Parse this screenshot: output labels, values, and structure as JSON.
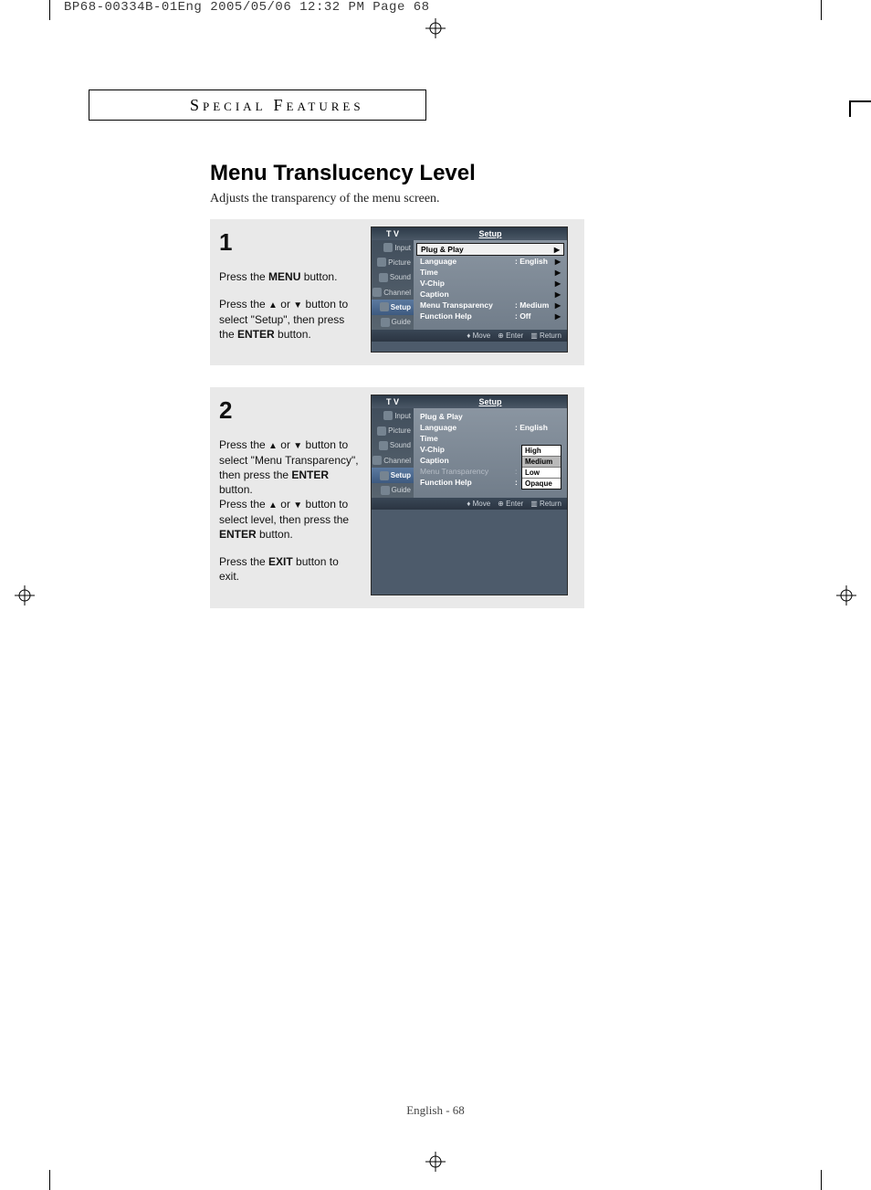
{
  "slug": "BP68-00334B-01Eng  2005/05/06  12:32 PM  Page 68",
  "section_header": "SPECIAL FEATURES",
  "title": "Menu Translucency Level",
  "subtitle": "Adjusts the transparency of the menu screen.",
  "steps": [
    {
      "num": "1",
      "paras": [
        "Press the <b>MENU</b> button.",
        "Press the <span class='tri'>▲</span> or <span class='tri'>▼</span> button to select \"Setup\", then press the <b>ENTER</b> button."
      ]
    },
    {
      "num": "2",
      "paras": [
        "Press the <span class='tri'>▲</span> or <span class='tri'>▼</span> button to select \"Menu Transparency\", then press the <b>ENTER</b> button.<br>Press the <span class='tri'>▲</span> or <span class='tri'>▼</span> button to select level, then press the <b>ENTER</b> button.",
        "Press the <b>EXIT</b> button to exit."
      ]
    }
  ],
  "osd": {
    "head_left": "T V",
    "head_right": "Setup",
    "nav": [
      "Input",
      "Picture",
      "Sound",
      "Channel",
      "Setup",
      "Guide"
    ],
    "nav_selected": "Setup",
    "foot": [
      "Move",
      "Enter",
      "Return"
    ]
  },
  "osd1": {
    "rows": [
      {
        "label": "Plug & Play",
        "value": "",
        "arrow": "▶",
        "hl": true
      },
      {
        "label": "Language",
        "value": ": English",
        "arrow": "▶"
      },
      {
        "label": "Time",
        "value": "",
        "arrow": "▶"
      },
      {
        "label": "V-Chip",
        "value": "",
        "arrow": "▶"
      },
      {
        "label": "Caption",
        "value": "",
        "arrow": "▶"
      },
      {
        "label": "Menu Transparency",
        "value": ": Medium",
        "arrow": "▶"
      },
      {
        "label": "Function Help",
        "value": ": Off",
        "arrow": "▶"
      }
    ]
  },
  "osd2": {
    "rows": [
      {
        "label": "Plug & Play",
        "value": ""
      },
      {
        "label": "Language",
        "value": ": English"
      },
      {
        "label": "Time",
        "value": ""
      },
      {
        "label": "V-Chip",
        "value": ""
      },
      {
        "label": "Caption",
        "value": ""
      },
      {
        "label": "Menu Transparency",
        "value": ":",
        "dim": true
      },
      {
        "label": "Function Help",
        "value": ":"
      }
    ],
    "popup": [
      "High",
      "Medium",
      "Low",
      "Opaque"
    ],
    "popup_selected": "Medium"
  },
  "footer": "English - 68"
}
